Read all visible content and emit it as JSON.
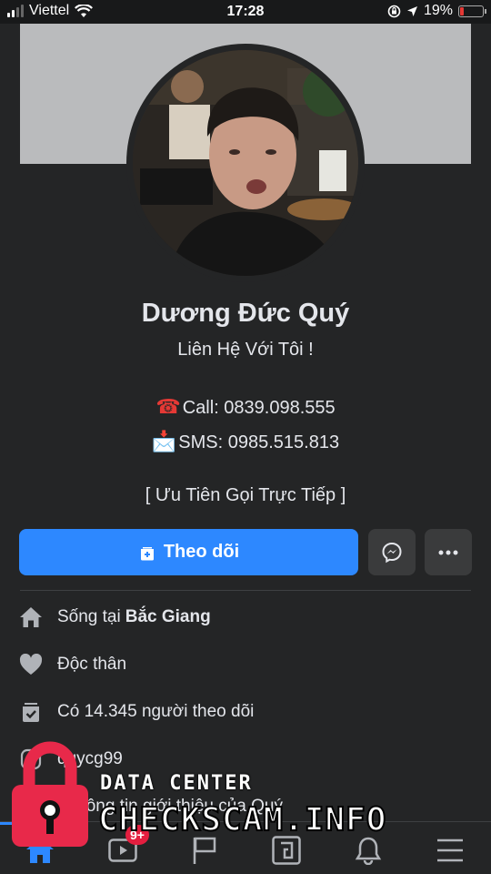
{
  "status_bar": {
    "carrier": "Viettel",
    "time": "17:28",
    "battery_percent": "19%",
    "battery_level": 0.19,
    "signal_bars": 2,
    "icons": [
      "signal-icon",
      "wifi-icon",
      "rotation-lock-icon",
      "location-arrow-icon",
      "battery-icon"
    ]
  },
  "profile": {
    "name": "Dương Đức Quý",
    "bio": {
      "line1": "Liên Hệ Với Tôi !",
      "call_emoji": "☎",
      "call": "Call: 0839.098.555",
      "sms_emoji": "📩",
      "sms": "SMS: 0985.515.813",
      "line4": "[ Ưu Tiên Gọi Trực Tiếp ]"
    }
  },
  "actions": {
    "follow_label": "Theo dõi",
    "follow_icon": "follow-plus-icon",
    "messenger_icon": "messenger-icon",
    "more_icon": "more-dots-icon"
  },
  "details": {
    "lives_in_prefix": "Sống tại",
    "lives_in_place": "Bắc Giang",
    "relationship": "Độc thân",
    "followers": "Có 14.345 người theo dõi",
    "instagram": "quycg99",
    "see_about": "n thông tin giới thiệu của Quý"
  },
  "bottom_nav": {
    "items": [
      "home-icon",
      "watch-icon",
      "pages-flag-icon",
      "gaming-icon",
      "notifications-bell-icon",
      "menu-icon"
    ],
    "watch_badge": "9+"
  },
  "watermark": {
    "line1": "DATA CENTER",
    "line2": "CHECKSCAM.INFO"
  },
  "colors": {
    "background": "#242526",
    "accent": "#2d88ff",
    "cover": "#babbbd",
    "badge": "#e41e3f",
    "lock": "#e8294a"
  }
}
